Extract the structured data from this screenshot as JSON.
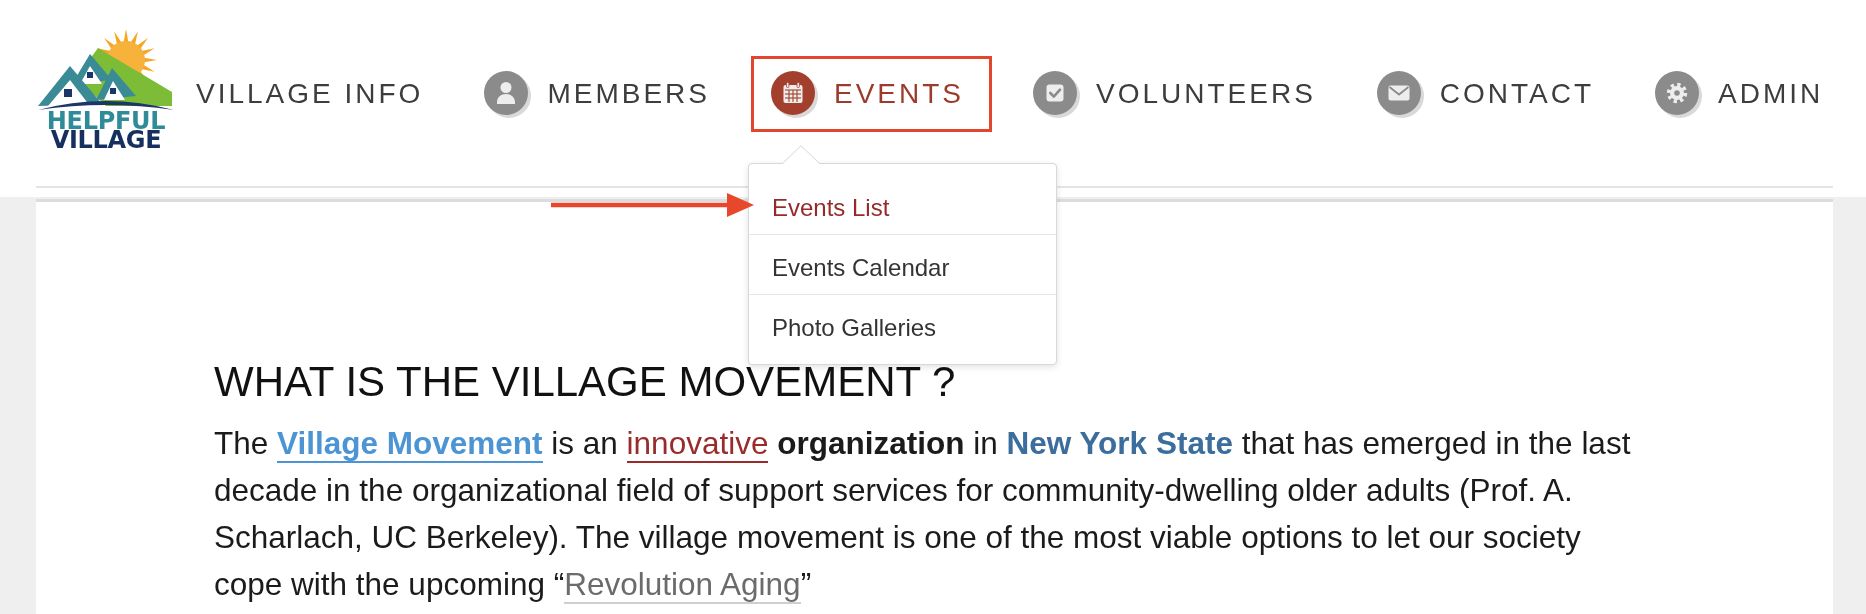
{
  "logo": {
    "lines": [
      "HELPFUL",
      "VILLAGE"
    ]
  },
  "nav": [
    {
      "label": "VILLAGE INFO",
      "selected": false
    },
    {
      "label": "MEMBERS",
      "selected": false
    },
    {
      "label": "EVENTS",
      "selected": true,
      "menu": [
        {
          "label": "Events List",
          "selected": true
        },
        {
          "label": "Events Calendar",
          "selected": false
        },
        {
          "label": "Photo Galleries",
          "selected": false
        }
      ]
    },
    {
      "label": "VOLUNTEERS",
      "selected": false
    },
    {
      "label": "CONTACT",
      "selected": false
    },
    {
      "label": "ADMIN",
      "selected": false
    }
  ],
  "article": {
    "heading": "WHAT IS THE VILLAGE MOVEMENT ?",
    "paragraph": [
      {
        "kind": "text",
        "text": "The "
      },
      {
        "kind": "link",
        "text": "Village Movement"
      },
      {
        "kind": "text",
        "text": " is an "
      },
      {
        "kind": "accent-link",
        "text": "innovative"
      },
      {
        "kind": "text",
        "text": " **organization** in "
      },
      {
        "kind": "strong-link",
        "text": "New York State"
      },
      {
        "kind": "text",
        "text": " that has emerged in the last decade in the organizational field of support services for community-dwelling older adults (Prof. A. Scharlach, UC Berkeley). The village movement is one of the most viable options to let our society cope with the upcoming “"
      },
      {
        "kind": "muted-link",
        "text": "Revolution Aging"
      },
      {
        "kind": "text",
        "text": "”"
      }
    ]
  }
}
